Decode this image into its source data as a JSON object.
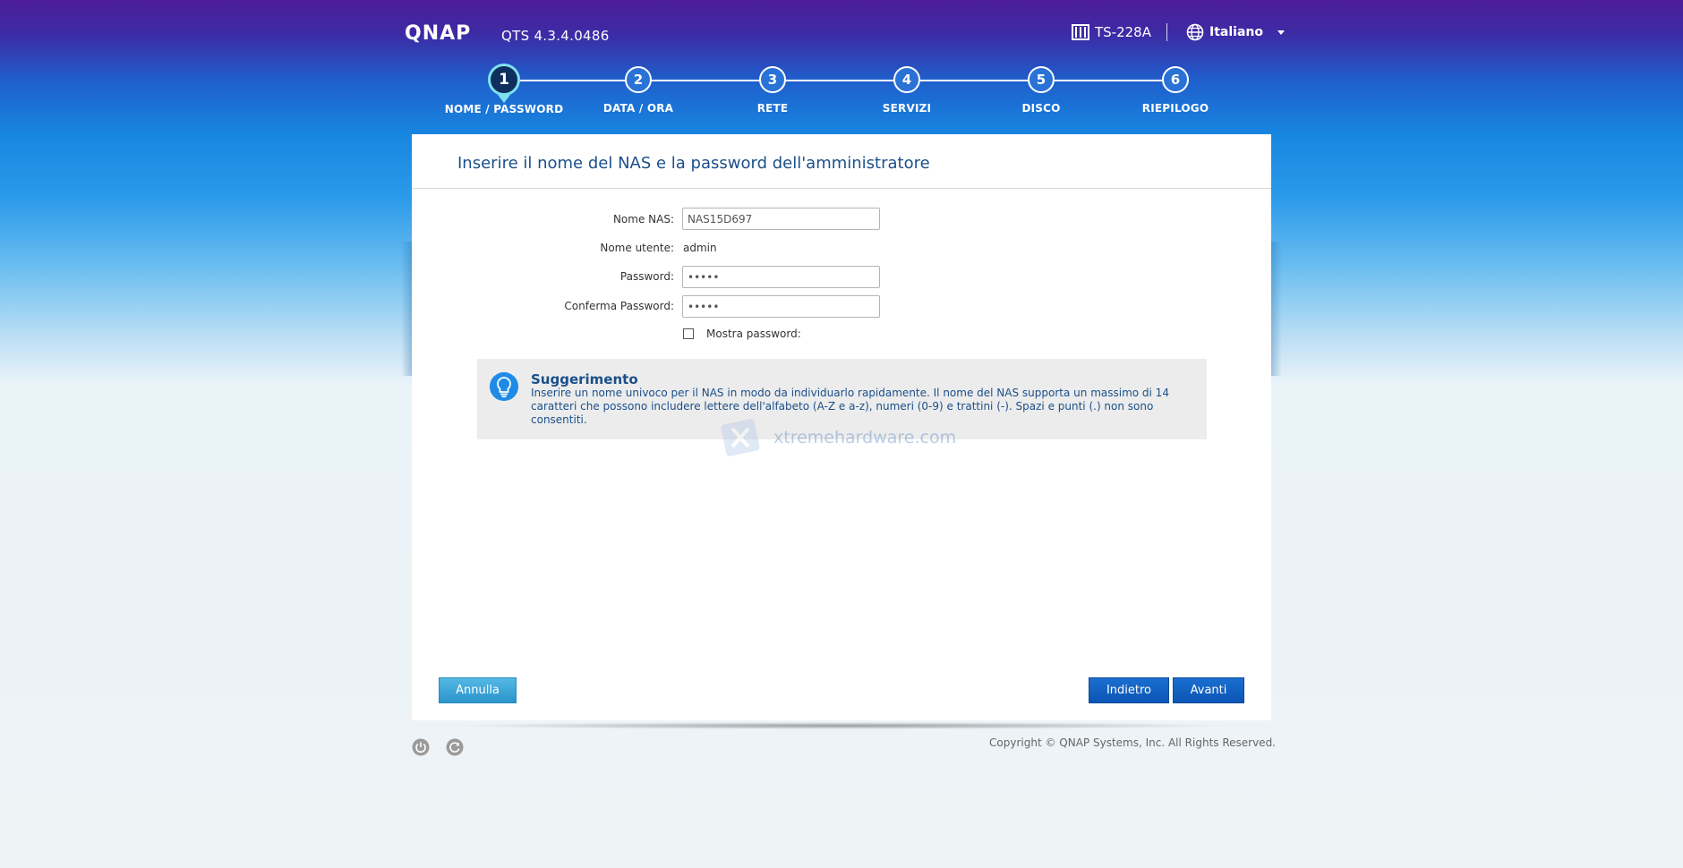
{
  "header": {
    "logo_text": "QNAP",
    "version": "QTS 4.3.4.0486",
    "model": "TS-228A",
    "language": "Italiano"
  },
  "steps": [
    {
      "number": "1",
      "label": "NOME / PASSWORD"
    },
    {
      "number": "2",
      "label": "DATA / ORA"
    },
    {
      "number": "3",
      "label": "RETE"
    },
    {
      "number": "4",
      "label": "SERVIZI"
    },
    {
      "number": "5",
      "label": "DISCO"
    },
    {
      "number": "6",
      "label": "RIEPILOGO"
    }
  ],
  "panel": {
    "title": "Inserire il nome del NAS e la password dell'amministratore",
    "form": {
      "nas_name_label": "Nome NAS:",
      "nas_name_value": "NAS15D697",
      "username_label": "Nome utente:",
      "username_value": "admin",
      "password_label": "Password:",
      "password_value": "•••••",
      "confirm_label": "Conferma Password:",
      "confirm_value": "•••••",
      "show_password_label": "Mostra password:"
    },
    "tip": {
      "title": "Suggerimento",
      "text": "Inserire un nome univoco per il NAS in modo da individuarlo rapidamente. Il nome del NAS supporta un massimo di 14 caratteri che possono includere lettere dell'alfabeto (A-Z e a-z), numeri (0-9) e trattini (-). Spazi e punti (.) non sono consentiti."
    },
    "buttons": {
      "cancel": "Annulla",
      "back": "Indietro",
      "next": "Avanti"
    }
  },
  "watermark": "xtremehardware.com",
  "footer": {
    "copyright": "Copyright © QNAP Systems, Inc. All Rights Reserved."
  },
  "colors": {
    "accent": "#0b55b5",
    "title": "#1b4f8a",
    "active_step": "#7fe0ee"
  }
}
